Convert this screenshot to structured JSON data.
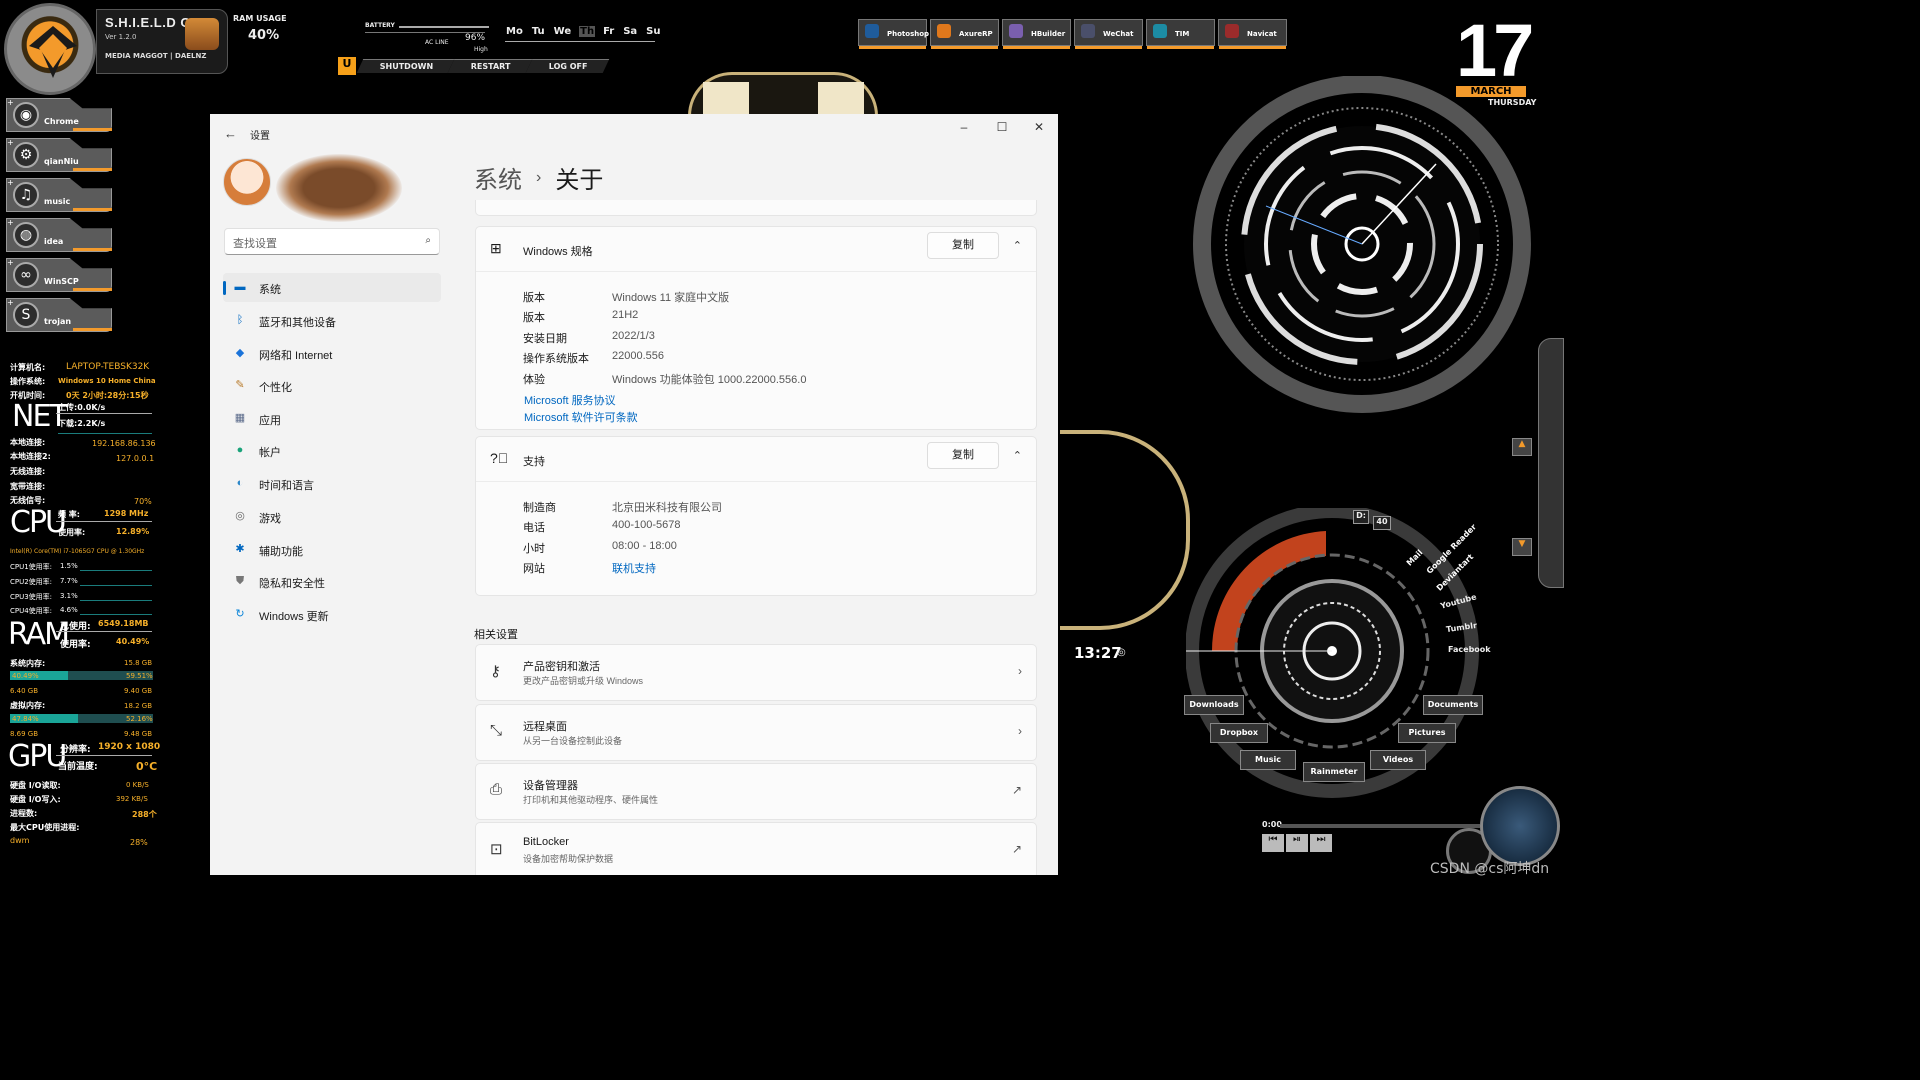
{
  "os_widget": {
    "title": "S.H.I.E.L.D OS",
    "version": "Ver 1.2.0",
    "subtitle": "MEDIA MAGGOT | DAELNZ",
    "ram_label": "RAM USAGE",
    "ram_value": "40%"
  },
  "battery": {
    "label": "BATTERY",
    "source": "AC LINE",
    "percent": "96%",
    "state": "High"
  },
  "weekdays": [
    {
      "d": "Mo"
    },
    {
      "d": "Tu"
    },
    {
      "d": "We"
    },
    {
      "d": "Th"
    },
    {
      "d": "Fr"
    },
    {
      "d": "Sa"
    },
    {
      "d": "Su"
    }
  ],
  "power": {
    "shutdown": "SHUTDOWN",
    "restart": "RESTART",
    "logoff": "LOG OFF"
  },
  "dock": [
    "Photoshop",
    "AxureRP",
    "HBuilder",
    "WeChat",
    "TIM",
    "Navicat"
  ],
  "date": {
    "day": "17",
    "month": "MARCH",
    "weekday": "THURSDAY"
  },
  "launcher": [
    "Chrome",
    "qianNiu",
    "music",
    "idea",
    "WinSCP",
    "trojan"
  ],
  "sysinfo": {
    "computer_label": "计算机名:",
    "computer": "LAPTOP-TEBSK32K",
    "os_label": "操作系统:",
    "os": "Windows 10 Home China",
    "uptime_label": "开机时间:",
    "uptime": "0天 2小时:28分:15秒",
    "net_big": "NET",
    "upload": "上传:0.0K/s",
    "download": "下载:2.2K/s",
    "lan1_label": "本地连接:",
    "lan1": "192.168.86.136",
    "lan2_label": "本地连接2:",
    "lan2": "127.0.0.1",
    "wifi_label": "无线连接:",
    "broadband_label": "宽带连接:",
    "signal_label": "无线信号:",
    "signal": "70%",
    "cpu_big": "CPU",
    "freq_label": "频  率:",
    "freq": "1298 MHz",
    "usage_label": "使用率:",
    "usage": "12.89%",
    "cpu_model": "Intel(R) Core(TM) i7-1065G7 CPU @ 1.30GHz",
    "cores": [
      {
        "l": "CPU1使用率:",
        "v": "1.5%"
      },
      {
        "l": "CPU2使用率:",
        "v": "7.7%"
      },
      {
        "l": "CPU3使用率:",
        "v": "3.1%"
      },
      {
        "l": "CPU4使用率:",
        "v": "4.6%"
      }
    ],
    "ram_big": "RAM",
    "ram_used_label": "已使用:",
    "ram_used": "6549.18MB",
    "ram_usage_label": "使用率:",
    "ram_usage": "40.49%",
    "sysmem_label": "系统内存:",
    "sysmem_total": "15.8 GB",
    "sysmem_pct": "40.49%",
    "sysmem_free_pct": "59.51%",
    "sysmem_used": "6.40 GB",
    "sysmem_free": "9.40 GB",
    "sysmem_fill": 0.405,
    "virt_label": "虚拟内存:",
    "virt_total": "18.2 GB",
    "virt_pct": "47.84%",
    "virt_free_pct": "52.16%",
    "virt_used": "8.69 GB",
    "virt_free": "9.48 GB",
    "virt_fill": 0.478,
    "gpu_big": "GPU",
    "res_label": "分辨率:",
    "res": "1920 x 1080",
    "temp_label": "当前温度:",
    "temp": "0°C",
    "disk_r_label": "硬盘 I/O读取:",
    "disk_r": "0 KB/S",
    "disk_w_label": "硬盘 I/O写入:",
    "disk_w": "392 KB/S",
    "proc_label": "进程数:",
    "proc": "288个",
    "maxcpu_label": "最大CPU使用进程:",
    "maxcpu_proc": "dwm",
    "maxcpu": "28%"
  },
  "settings": {
    "title": "设置",
    "search_placeholder": "查找设置",
    "nav": [
      {
        "label": "系统",
        "icon": "display-icon"
      },
      {
        "label": "蓝牙和其他设备",
        "icon": "bluetooth-icon"
      },
      {
        "label": "网络和 Internet",
        "icon": "wifi-icon"
      },
      {
        "label": "个性化",
        "icon": "brush-icon"
      },
      {
        "label": "应用",
        "icon": "apps-icon"
      },
      {
        "label": "帐户",
        "icon": "account-icon"
      },
      {
        "label": "时间和语言",
        "icon": "globe-icon"
      },
      {
        "label": "游戏",
        "icon": "gamepad-icon"
      },
      {
        "label": "辅助功能",
        "icon": "accessibility-icon"
      },
      {
        "label": "隐私和安全性",
        "icon": "shield-icon"
      },
      {
        "label": "Windows 更新",
        "icon": "update-icon"
      }
    ],
    "breadcrumb": {
      "parent": "系统",
      "sep": "›",
      "current": "关于"
    },
    "spec": {
      "title": "Windows 规格",
      "copy": "复制",
      "rows": [
        {
          "k": "版本",
          "v": "Windows 11 家庭中文版"
        },
        {
          "k": "版本",
          "v": "21H2"
        },
        {
          "k": "安装日期",
          "v": "2022/1/3"
        },
        {
          "k": "操作系统版本",
          "v": "22000.556"
        },
        {
          "k": "体验",
          "v": "Windows 功能体验包 1000.22000.556.0"
        }
      ],
      "links": [
        "Microsoft 服务协议",
        "Microsoft 软件许可条款"
      ]
    },
    "support": {
      "title": "支持",
      "copy": "复制",
      "rows": [
        {
          "k": "制造商",
          "v": "北京田米科技有限公司"
        },
        {
          "k": "电话",
          "v": "400-100-5678"
        },
        {
          "k": "小时",
          "v": "08:00 - 18:00"
        },
        {
          "k": "网站",
          "v": "联机支持"
        }
      ]
    },
    "related_title": "相关设置",
    "related": [
      {
        "title": "产品密钥和激活",
        "sub": "更改产品密钥或升级 Windows",
        "icon": "key-icon",
        "action": "chevron"
      },
      {
        "title": "远程桌面",
        "sub": "从另一台设备控制此设备",
        "icon": "remote-icon",
        "action": "chevron"
      },
      {
        "title": "设备管理器",
        "sub": "打印机和其他驱动程序、硬件属性",
        "icon": "printer-icon",
        "action": "external"
      },
      {
        "title": "BitLocker",
        "sub": "设备加密帮助保护数据",
        "icon": "lock-icon",
        "action": "external"
      }
    ]
  },
  "right_widget": {
    "time": "13:27",
    "disk": "D:",
    "disk_val": "40",
    "links": [
      "Mail",
      "Google Reader",
      "Deviantart",
      "Youtube",
      "Tumblr",
      "Facebook"
    ],
    "folders": [
      "Downloads",
      "Documents",
      "Dropbox",
      "Pictures",
      "Music",
      "Videos",
      "Rainmeter"
    ],
    "player_time": "0:00"
  },
  "watermark": "CSDN @cs阿坤dn"
}
